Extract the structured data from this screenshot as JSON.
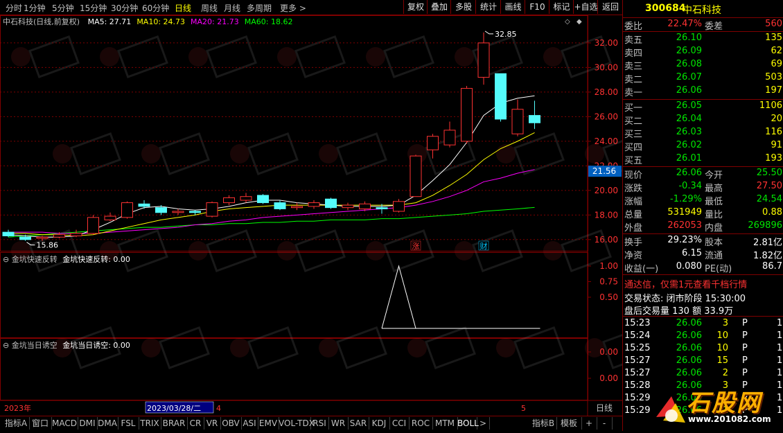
{
  "periods": [
    "分时",
    "1分钟",
    "5分钟",
    "15分钟",
    "30分钟",
    "60分钟",
    "日线",
    "周线",
    "月线",
    "多周期",
    "更多"
  ],
  "active_period": "日线",
  "toolbar": [
    "复权",
    "叠加",
    "多股",
    "统计",
    "画线",
    "F10",
    "标记",
    "+自选",
    "返回"
  ],
  "chart": {
    "title": "中石科技(日线,前复权)",
    "ma": [
      {
        "label": "MA5: 27.71",
        "color": "#ffffff"
      },
      {
        "label": "MA10: 24.73",
        "color": "#ffff00"
      },
      {
        "label": "MA20: 21.73",
        "color": "#ff00ff"
      },
      {
        "label": "MA60: 18.62",
        "color": "#00ff00"
      }
    ],
    "y_ticks": [
      "32.00",
      "30.00",
      "28.00",
      "26.00",
      "24.00",
      "22.00",
      "20.00",
      "18.00",
      "16.00"
    ],
    "current_price_tag": "21.56",
    "high_label": "32.85",
    "low_label": "15.86",
    "markers": [
      {
        "text": "涨",
        "color": "#ff3232"
      },
      {
        "text": "财",
        "color": "#00c8ff"
      }
    ],
    "candles": [
      {
        "o": 16.6,
        "c": 16.3,
        "h": 16.8,
        "l": 16.2
      },
      {
        "o": 16.2,
        "c": 16.0,
        "h": 16.4,
        "l": 15.9
      },
      {
        "o": 16.1,
        "c": 16.2,
        "h": 16.3,
        "l": 15.9
      },
      {
        "o": 16.2,
        "c": 16.4,
        "h": 16.6,
        "l": 16.1
      },
      {
        "o": 16.3,
        "c": 16.5,
        "h": 16.8,
        "l": 16.2
      },
      {
        "o": 16.5,
        "c": 17.8,
        "h": 18.0,
        "l": 16.4
      },
      {
        "o": 17.6,
        "c": 17.9,
        "h": 18.2,
        "l": 17.5
      },
      {
        "o": 17.8,
        "c": 19.0,
        "h": 19.1,
        "l": 17.7
      },
      {
        "o": 18.9,
        "c": 18.7,
        "h": 19.2,
        "l": 18.5
      },
      {
        "o": 18.6,
        "c": 18.2,
        "h": 18.8,
        "l": 18.0
      },
      {
        "o": 18.2,
        "c": 18.3,
        "h": 18.5,
        "l": 18.0
      },
      {
        "o": 18.3,
        "c": 18.2,
        "h": 18.4,
        "l": 18.0
      },
      {
        "o": 17.9,
        "c": 19.0,
        "h": 19.1,
        "l": 17.8
      },
      {
        "o": 19.0,
        "c": 19.4,
        "h": 19.6,
        "l": 18.8
      },
      {
        "o": 19.2,
        "c": 19.5,
        "h": 19.8,
        "l": 19.0
      },
      {
        "o": 19.6,
        "c": 19.0,
        "h": 19.7,
        "l": 18.9
      },
      {
        "o": 19.0,
        "c": 18.5,
        "h": 19.2,
        "l": 18.4
      },
      {
        "o": 18.6,
        "c": 18.7,
        "h": 19.0,
        "l": 18.4
      },
      {
        "o": 18.7,
        "c": 19.0,
        "h": 19.2,
        "l": 18.5
      },
      {
        "o": 19.3,
        "c": 18.6,
        "h": 19.4,
        "l": 18.5
      },
      {
        "o": 18.6,
        "c": 18.8,
        "h": 19.0,
        "l": 18.4
      },
      {
        "o": 18.5,
        "c": 18.9,
        "h": 19.1,
        "l": 18.3
      },
      {
        "o": 18.6,
        "c": 18.5,
        "h": 18.9,
        "l": 18.1
      },
      {
        "o": 18.3,
        "c": 19.1,
        "h": 19.3,
        "l": 18.2
      },
      {
        "o": 19.5,
        "c": 22.8,
        "h": 22.9,
        "l": 19.5
      },
      {
        "o": 23.3,
        "c": 24.4,
        "h": 24.6,
        "l": 22.6
      },
      {
        "o": 23.7,
        "c": 24.9,
        "h": 25.6,
        "l": 23.5
      },
      {
        "o": 24.0,
        "c": 28.3,
        "h": 28.5,
        "l": 23.8
      },
      {
        "o": 29.2,
        "c": 32.0,
        "h": 32.85,
        "l": 28.6
      },
      {
        "o": 29.5,
        "c": 25.8,
        "h": 29.5,
        "l": 25.6
      },
      {
        "o": 24.6,
        "c": 26.6,
        "h": 27.4,
        "l": 24.4
      },
      {
        "o": 26.1,
        "c": 25.5,
        "h": 27.3,
        "l": 25.0
      }
    ],
    "ma5": [
      16.4,
      16.3,
      16.2,
      16.2,
      16.3,
      16.8,
      17.4,
      18.1,
      18.6,
      18.7,
      18.5,
      18.4,
      18.5,
      18.7,
      19.0,
      19.2,
      19.2,
      19.0,
      18.9,
      18.8,
      18.7,
      18.7,
      18.7,
      18.8,
      19.6,
      20.8,
      22.1,
      23.9,
      26.1,
      27.1,
      27.5,
      27.7
    ],
    "ma10": [
      16.5,
      16.5,
      16.4,
      16.4,
      16.3,
      16.4,
      16.7,
      17.0,
      17.3,
      17.6,
      17.8,
      18.0,
      18.3,
      18.5,
      18.6,
      18.7,
      18.8,
      18.8,
      18.8,
      18.8,
      18.8,
      18.8,
      18.8,
      18.8,
      19.0,
      19.6,
      20.4,
      21.3,
      22.5,
      23.4,
      24.0,
      24.7
    ],
    "ma20": [
      16.6,
      16.6,
      16.6,
      16.5,
      16.5,
      16.5,
      16.6,
      16.7,
      16.8,
      16.9,
      17.0,
      17.2,
      17.3,
      17.5,
      17.6,
      17.8,
      17.9,
      18.0,
      18.1,
      18.2,
      18.3,
      18.4,
      18.5,
      18.6,
      18.8,
      19.1,
      19.5,
      20.0,
      20.7,
      21.0,
      21.4,
      21.7
    ],
    "ma60": [
      16.2,
      16.3,
      16.4,
      16.5,
      16.6,
      16.7,
      16.8,
      16.9,
      17.0,
      17.0,
      17.1,
      17.2,
      17.2,
      17.3,
      17.3,
      17.4,
      17.4,
      17.5,
      17.5,
      17.6,
      17.6,
      17.6,
      17.7,
      17.7,
      17.8,
      17.9,
      18.0,
      18.1,
      18.3,
      18.4,
      18.5,
      18.62
    ],
    "ylim": [
      15.2,
      33.8
    ]
  },
  "ind1": {
    "title": "金坑快速反转",
    "value_label": "金坑快速反转: 0.00",
    "y_ticks": [
      "1.00",
      "0.75",
      "0.50"
    ],
    "signal_index": 23
  },
  "ind2": {
    "title": "金坑当日诱空",
    "value_label": "金坑当日诱空: 0.00",
    "y_ticks": [
      "0.00",
      "0.00"
    ]
  },
  "axis": {
    "year": "2023年",
    "date": "2023/03/28/二",
    "m4": "4",
    "m5": "5",
    "period": "日线"
  },
  "tabs": [
    "指标A",
    "窗口",
    "MACD",
    "DMI",
    "DMA",
    "FSL",
    "TRIX",
    "BRAR",
    "CR",
    "VR",
    "OBV",
    "ASI",
    "EMV",
    "VOL-TDX",
    "RSI",
    "WR",
    "SAR",
    "KDJ",
    "CCI",
    "ROC",
    "MTM",
    "BOLL",
    ">",
    "指标B",
    "模板",
    "+",
    "-"
  ],
  "quote": {
    "code": "300684",
    "name": "中石科技",
    "webi_label": "委比",
    "webi": "22.47%",
    "weicha_label": "委差",
    "weicha": "560",
    "sell": [
      {
        "l": "卖五",
        "p": "26.10",
        "v": "135"
      },
      {
        "l": "卖四",
        "p": "26.09",
        "v": "62"
      },
      {
        "l": "卖三",
        "p": "26.08",
        "v": "69"
      },
      {
        "l": "卖二",
        "p": "26.07",
        "v": "503"
      },
      {
        "l": "卖一",
        "p": "26.06",
        "v": "197"
      }
    ],
    "buy": [
      {
        "l": "买一",
        "p": "26.05",
        "v": "1106"
      },
      {
        "l": "买二",
        "p": "26.04",
        "v": "20"
      },
      {
        "l": "买三",
        "p": "26.03",
        "v": "116"
      },
      {
        "l": "买四",
        "p": "26.02",
        "v": "91"
      },
      {
        "l": "买五",
        "p": "26.01",
        "v": "193"
      }
    ],
    "stats": [
      {
        "l1": "现价",
        "v1": "26.06",
        "c1": "green",
        "l2": "今开",
        "v2": "25.50",
        "c2": "green"
      },
      {
        "l1": "涨跌",
        "v1": "-0.34",
        "c1": "green",
        "l2": "最高",
        "v2": "27.50",
        "c2": "red"
      },
      {
        "l1": "涨幅",
        "v1": "-1.29%",
        "c1": "green",
        "l2": "最低",
        "v2": "24.54",
        "c2": "green"
      },
      {
        "l1": "总量",
        "v1": "531949",
        "c1": "yellow",
        "l2": "量比",
        "v2": "0.88",
        "c2": "yellow"
      },
      {
        "l1": "外盘",
        "v1": "262053",
        "c1": "red",
        "l2": "内盘",
        "v2": "269896",
        "c2": "green"
      }
    ],
    "stats2": [
      {
        "l1": "换手",
        "v1": "29.23%",
        "l2": "股本",
        "v2": "2.81亿"
      },
      {
        "l1": "净资",
        "v1": "6.15",
        "l2": "流通",
        "v2": "1.82亿"
      },
      {
        "l1": "收益(一)",
        "v1": "0.080",
        "l2": "PE(动)",
        "v2": "86.7"
      }
    ],
    "ad": "通达信，仅需1元查看千档行情",
    "status": "交易状态: 闭市阶段 15:30:00",
    "after": "盘后交易量 130 额 33.9万",
    "ticks": [
      {
        "t": "15:23",
        "p": "26.06",
        "v": "3",
        "f": "P"
      },
      {
        "t": "15:24",
        "p": "26.06",
        "v": "10",
        "f": "P"
      },
      {
        "t": "15:25",
        "p": "26.06",
        "v": "10",
        "f": "P"
      },
      {
        "t": "15:27",
        "p": "26.06",
        "v": "15",
        "f": "P"
      },
      {
        "t": "15:27",
        "p": "26.06",
        "v": "2",
        "f": "P"
      },
      {
        "t": "15:28",
        "p": "26.06",
        "v": "3",
        "f": "P"
      },
      {
        "t": "15:29",
        "p": "26.06",
        "v": "1",
        "f": "P"
      },
      {
        "t": "15:29",
        "p": "26.06",
        "v": "1",
        "f": "P"
      }
    ],
    "tick_extra": "1"
  },
  "watermark": {
    "text": "石股网",
    "url": "www.201082.com"
  },
  "colors": {
    "up": "#ff3232",
    "down": "#54fcfc",
    "grid": "#800000",
    "bg": "#000000"
  }
}
